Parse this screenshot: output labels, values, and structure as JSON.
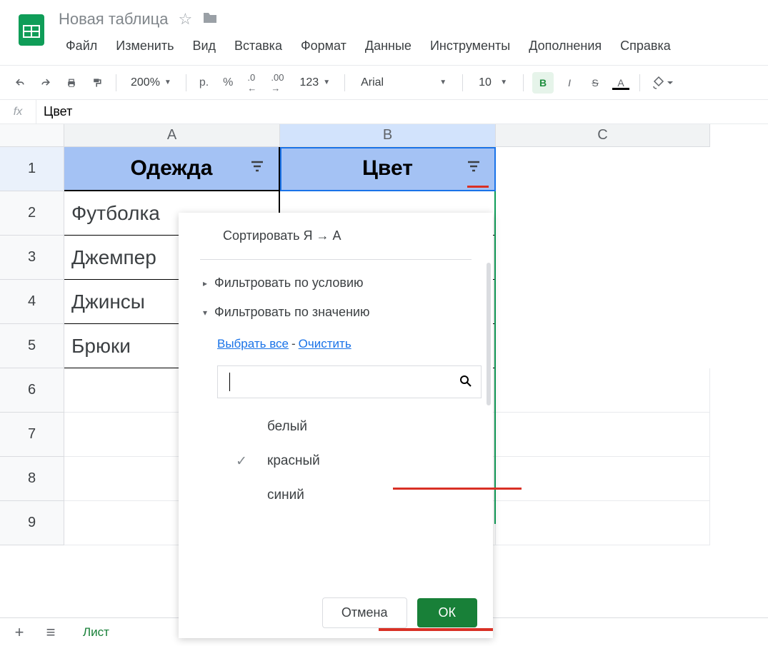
{
  "doc": {
    "title": "Новая таблица"
  },
  "menus": {
    "file": "Файл",
    "edit": "Изменить",
    "view": "Вид",
    "insert": "Вставка",
    "format": "Формат",
    "data": "Данные",
    "tools": "Инструменты",
    "addons": "Дополнения",
    "help": "Справка"
  },
  "toolbar": {
    "zoom": "200%",
    "currency": "р.",
    "percent": "%",
    "dec_less": ".0",
    "dec_more": ".00",
    "num_format": "123",
    "font": "Arial",
    "size": "10",
    "bold": "B",
    "italic": "I",
    "strike": "S",
    "textcolor": "A"
  },
  "formula_bar": {
    "fx": "fx",
    "value": "Цвет"
  },
  "columns": {
    "A": "A",
    "B": "B",
    "C": "C"
  },
  "rows": {
    "r1": "1",
    "r2": "2",
    "r3": "3",
    "r4": "4",
    "r5": "5",
    "r6": "6",
    "r7": "7",
    "r8": "8",
    "r9": "9"
  },
  "headers": {
    "A": "Одежда",
    "B": "Цвет"
  },
  "data": {
    "r2A": "Футболка",
    "r3A": "Джемпер",
    "r4A": "Джинсы",
    "r5A": "Брюки"
  },
  "filter": {
    "sort_desc": "Сортировать Я → А",
    "by_condition": "Фильтровать по условию",
    "by_value": "Фильтровать по значению",
    "select_all": "Выбрать все",
    "clear": "Очистить",
    "values": {
      "v1": "белый",
      "v2": "красный",
      "v3": "синий"
    },
    "cancel": "Отмена",
    "ok": "ОК"
  },
  "sheet_tabs": {
    "sheet1": "Лист"
  }
}
